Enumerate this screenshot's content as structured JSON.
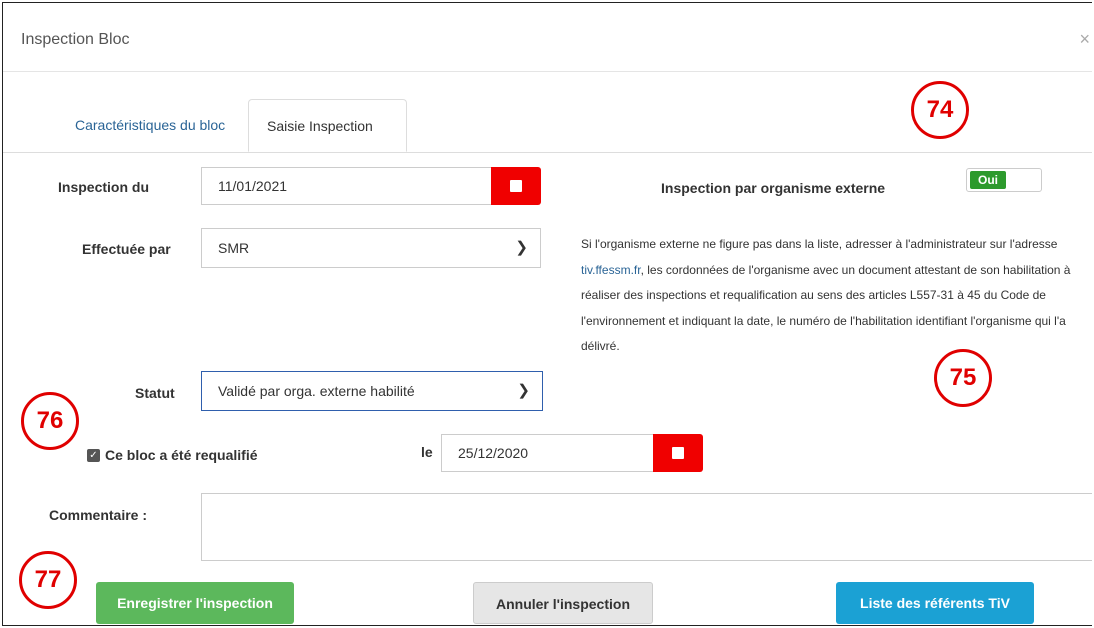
{
  "dialog": {
    "title": "Inspection Bloc",
    "close_symbol": "×"
  },
  "tabs": [
    {
      "label": "Caractéristiques du bloc",
      "active": false
    },
    {
      "label": "Saisie Inspection",
      "active": true
    }
  ],
  "form": {
    "inspection_date": {
      "label": "Inspection du",
      "value": "11/01/2021",
      "icon": "calendar-icon"
    },
    "performed_by": {
      "label": "Effectuée par",
      "value": "SMR"
    },
    "external_org": {
      "label": "Inspection par organisme externe",
      "toggle_label": "Oui",
      "toggle_on": true
    },
    "info": {
      "text_before_link": "Si l'organisme externe ne figure pas dans la liste, adresser à l'administrateur sur l'adresse ",
      "link_text": "tiv.ffessm.fr",
      "text_after_link": ", les cordonnées de l'organisme avec un document attestant de son habilitation à réaliser des inspections et requalification au sens des articles L557-31 à 45 du Code de l'environnement et indiquant la date, le numéro de l'habilitation identifiant l'organisme qui l'a délivré."
    },
    "status": {
      "label": "Statut",
      "value": "Validé par orga. externe habilité"
    },
    "requalified": {
      "label": "Ce bloc a été requalifié",
      "checked": true,
      "date_prefix": "le",
      "date_value": "25/12/2020"
    },
    "comment": {
      "label": "Commentaire :",
      "value": ""
    }
  },
  "buttons": {
    "save": "Enregistrer l'inspection",
    "cancel": "Annuler l'inspection",
    "referents": "Liste des référents TiV"
  },
  "callouts": [
    "74",
    "75",
    "76",
    "77"
  ],
  "colors": {
    "calendar_button": "#f00000",
    "save_button": "#5cb85c",
    "referents_button": "#1ba1d4",
    "toggle_on": "#2d9a2d",
    "callout": "#e00000",
    "link": "#2a6496"
  }
}
